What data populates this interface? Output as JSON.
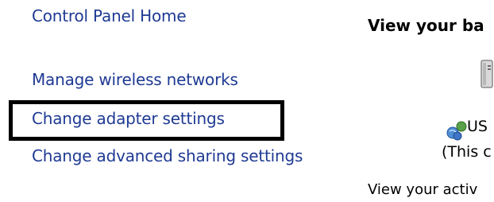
{
  "sidebar": {
    "links": [
      {
        "label": "Control Panel Home"
      },
      {
        "label": "Manage wireless networks"
      },
      {
        "label": "Change adapter settings"
      },
      {
        "label": "Change advanced sharing settings"
      }
    ],
    "highlighted_index": 2
  },
  "main": {
    "title": "View your ba",
    "network": {
      "name": "US",
      "subtext": "(This c",
      "icon": "network-globe-icon"
    },
    "computer_icon": "computer-icon",
    "active_label": "View your activ"
  },
  "colors": {
    "link": "#1f3a93",
    "highlight_border": "#000000",
    "background": "#ffffff"
  }
}
